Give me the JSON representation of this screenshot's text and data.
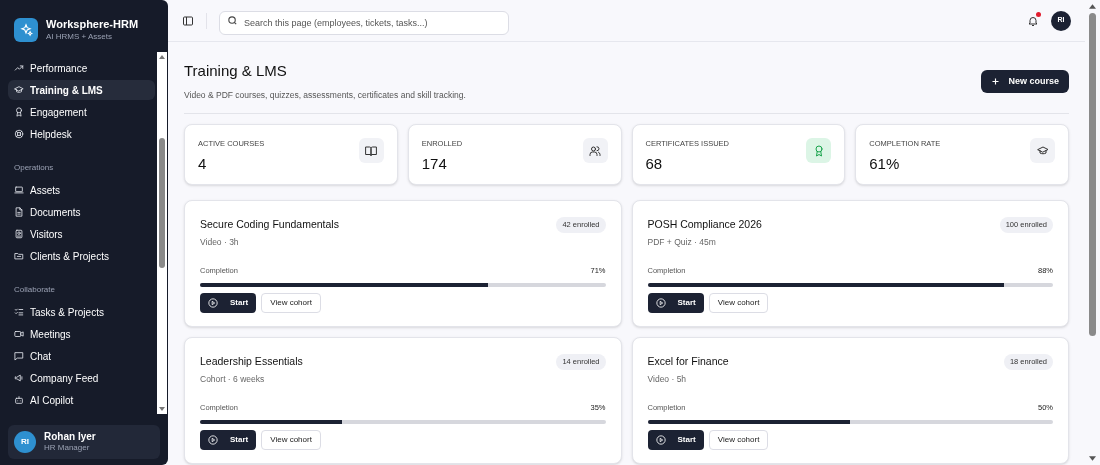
{
  "brand": {
    "name": "Worksphere-HRM",
    "tagline": "AI HRMS + Assets"
  },
  "sidebar": {
    "groups": [
      {
        "items": [
          {
            "label": "Performance",
            "selected": false
          },
          {
            "label": "Training & LMS",
            "selected": true
          },
          {
            "label": "Engagement",
            "selected": false
          },
          {
            "label": "Helpdesk",
            "selected": false
          }
        ]
      },
      {
        "heading": "Operations",
        "items": [
          {
            "label": "Assets",
            "selected": false
          },
          {
            "label": "Documents",
            "selected": false
          },
          {
            "label": "Visitors",
            "selected": false
          },
          {
            "label": "Clients & Projects",
            "selected": false
          }
        ]
      },
      {
        "heading": "Collaborate",
        "items": [
          {
            "label": "Tasks & Projects",
            "selected": false
          },
          {
            "label": "Meetings",
            "selected": false
          },
          {
            "label": "Chat",
            "selected": false
          },
          {
            "label": "Company Feed",
            "selected": false
          },
          {
            "label": "AI Copilot",
            "selected": false
          }
        ]
      }
    ]
  },
  "user": {
    "initials": "RI",
    "name": "Rohan Iyer",
    "role": "HR Manager"
  },
  "topbar": {
    "search_placeholder": "Search this page (employees, tickets, tasks...)",
    "notification_dot": true,
    "avatar": "RI"
  },
  "page": {
    "title": "Training & LMS",
    "subtitle": "Video & PDF courses, quizzes, assessments, certificates and skill tracking.",
    "primary_button": "New course"
  },
  "stats": [
    {
      "label": "ACTIVE COURSES",
      "value": "4",
      "color": "#f1f2f6"
    },
    {
      "label": "ENROLLED",
      "value": "174",
      "color": "#f1f2f6"
    },
    {
      "label": "CERTIFICATES ISSUED",
      "value": "68",
      "color": "#dcf5e6"
    },
    {
      "label": "COMPLETION RATE",
      "value": "61%",
      "color": "#f1f2f6"
    }
  ],
  "courses": [
    {
      "title": "Secure Coding Fundamentals",
      "meta": "Video · 3h",
      "enrolled": "42 enrolled",
      "progress_label": "Completion",
      "percent": "71%",
      "level": 0.71,
      "start": "Start",
      "cohort": "View cohort"
    },
    {
      "title": "POSH Compliance 2026",
      "meta": "PDF + Quiz · 45m",
      "enrolled": "100 enrolled",
      "progress_label": "Completion",
      "percent": "88%",
      "level": 0.88,
      "start": "Start",
      "cohort": "View cohort"
    },
    {
      "title": "Leadership Essentials",
      "meta": "Cohort · 6 weeks",
      "enrolled": "14 enrolled",
      "progress_label": "Completion",
      "percent": "35%",
      "level": 0.35,
      "start": "Start",
      "cohort": "View cohort"
    },
    {
      "title": "Excel for Finance",
      "meta": "Video · 5h",
      "enrolled": "18 enrolled",
      "progress_label": "Completion",
      "percent": "50%",
      "level": 0.5,
      "start": "Start",
      "cohort": "View cohort"
    }
  ]
}
